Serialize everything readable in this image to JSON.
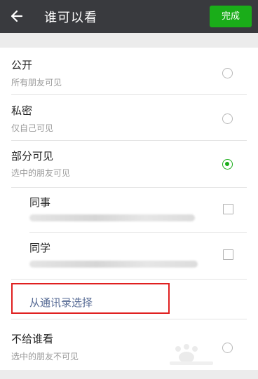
{
  "header": {
    "title": "谁可以看",
    "done_label": "完成"
  },
  "options": {
    "public": {
      "label": "公开",
      "desc": "所有朋友可见"
    },
    "private": {
      "label": "私密",
      "desc": "仅自己可见"
    },
    "partial": {
      "label": "部分可见",
      "desc": "选中的朋友可见"
    },
    "exclude": {
      "label": "不给谁看",
      "desc": "选中的朋友不可见"
    }
  },
  "tags": [
    {
      "label": "同事"
    },
    {
      "label": "同学"
    }
  ],
  "contacts_link": "从通讯录选择",
  "colors": {
    "accent": "#1aad19",
    "link": "#576b95",
    "highlight": "#e02020",
    "header_bg": "#393a3e"
  },
  "selected_option": "partial"
}
